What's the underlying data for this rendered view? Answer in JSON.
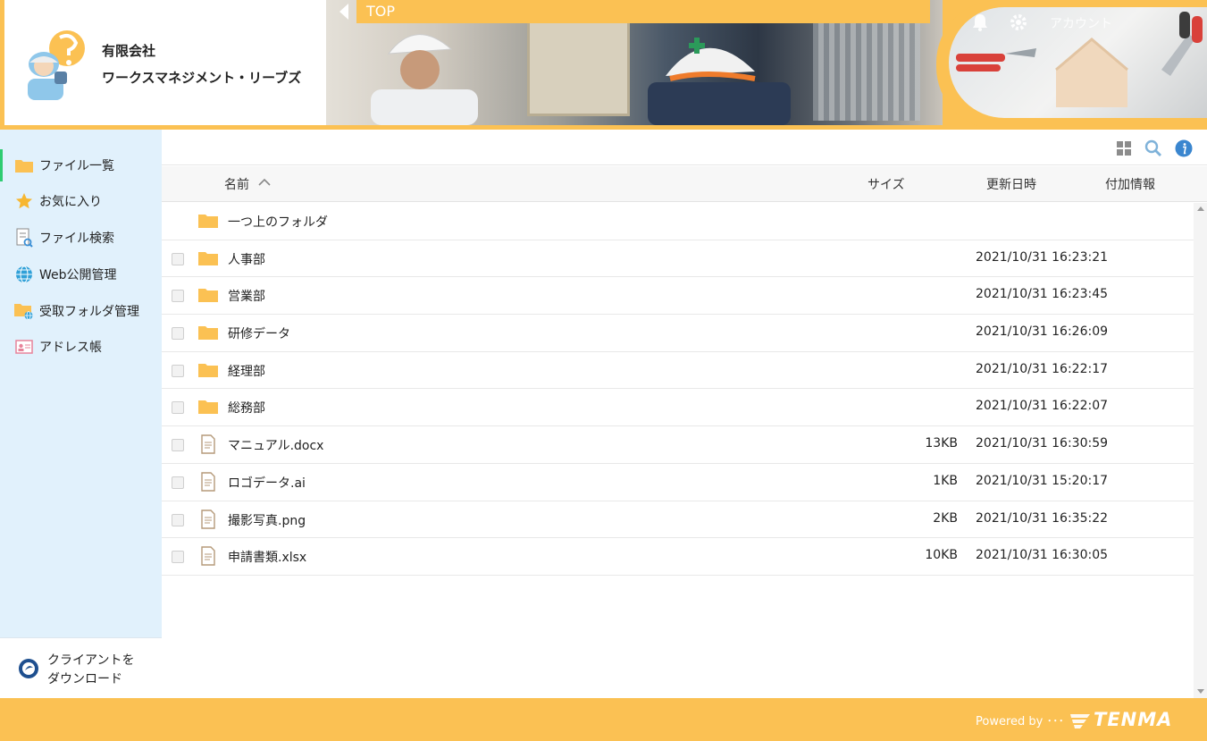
{
  "header": {
    "company_line1": "有限会社",
    "company_line2": "ワークスマネジメント・リーブズ",
    "breadcrumb": "TOP",
    "account_label": "アカウント",
    "accent_color": "#fbc153"
  },
  "sidebar": {
    "items": [
      {
        "label": "ファイル一覧",
        "icon": "folder-icon",
        "active": true
      },
      {
        "label": "お気に入り",
        "icon": "star-icon"
      },
      {
        "label": "ファイル検索",
        "icon": "file-search-icon"
      },
      {
        "label": "Web公開管理",
        "icon": "globe-icon"
      },
      {
        "label": "受取フォルダ管理",
        "icon": "folder-globe-icon"
      },
      {
        "label": "アドレス帳",
        "icon": "address-book-icon"
      }
    ],
    "client_download_line1": "クライアントを",
    "client_download_line2": "ダウンロード"
  },
  "table": {
    "columns": {
      "name": "名前",
      "size": "サイズ",
      "modified": "更新日時",
      "extra": "付加情報"
    },
    "rows": [
      {
        "type": "parent",
        "name": "一つ上のフォルダ",
        "size": "",
        "date": ""
      },
      {
        "type": "folder",
        "name": "人事部",
        "size": "",
        "date": "2021/10/31 16:23:21"
      },
      {
        "type": "folder",
        "name": "営業部",
        "size": "",
        "date": "2021/10/31 16:23:45"
      },
      {
        "type": "folder",
        "name": "研修データ",
        "size": "",
        "date": "2021/10/31 16:26:09"
      },
      {
        "type": "folder",
        "name": "経理部",
        "size": "",
        "date": "2021/10/31 16:22:17"
      },
      {
        "type": "folder",
        "name": "総務部",
        "size": "",
        "date": "2021/10/31 16:22:07"
      },
      {
        "type": "file",
        "name": "マニュアル.docx",
        "size": "13KB",
        "date": "2021/10/31 16:30:59"
      },
      {
        "type": "file",
        "name": "ロゴデータ.ai",
        "size": "1KB",
        "date": "2021/10/31 15:20:17"
      },
      {
        "type": "file",
        "name": "撮影写真.png",
        "size": "2KB",
        "date": "2021/10/31 16:35:22"
      },
      {
        "type": "file",
        "name": "申請書類.xlsx",
        "size": "10KB",
        "date": "2021/10/31 16:30:05"
      }
    ]
  },
  "footer": {
    "powered_by": "Powered by ･･･",
    "brand": "TENMA"
  }
}
